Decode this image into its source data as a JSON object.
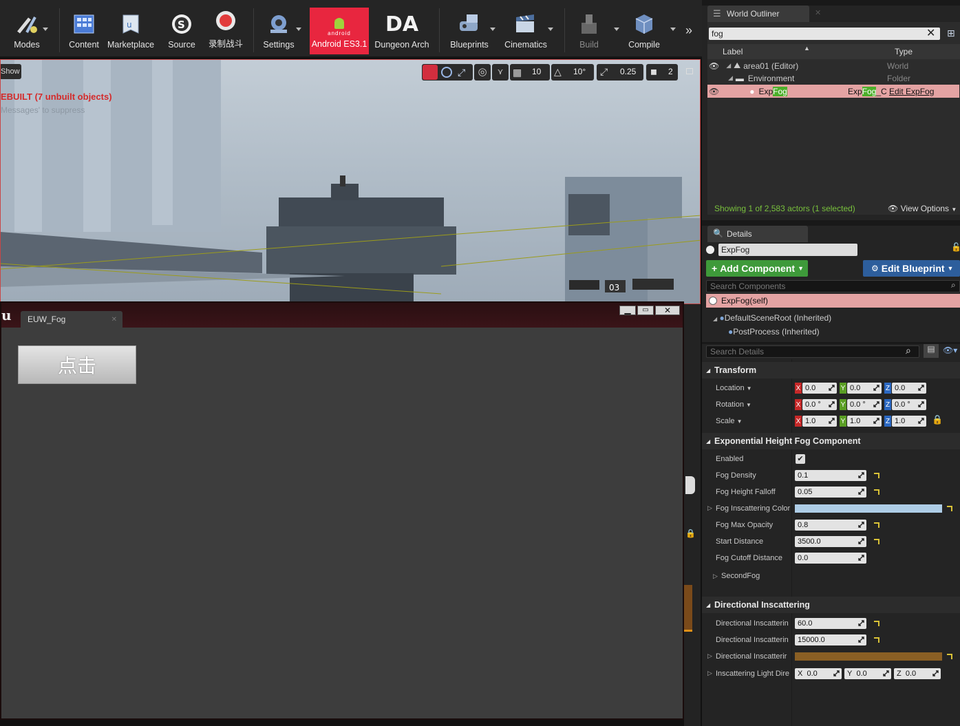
{
  "toolbar": {
    "buttons": [
      {
        "label": "Modes"
      },
      {
        "label": "Content"
      },
      {
        "label": "Marketplace"
      },
      {
        "label": "Source"
      },
      {
        "label": "录制战斗"
      },
      {
        "label": "Settings"
      },
      {
        "label": "Android ES3.1",
        "sub": "android"
      },
      {
        "label": "Dungeon Arch",
        "logo": "DA"
      },
      {
        "label": "Blueprints"
      },
      {
        "label": "Cinematics"
      },
      {
        "label": "Build"
      },
      {
        "label": "Compile"
      }
    ]
  },
  "viewport": {
    "show_button": "Show",
    "rebuild_msg": "EBUILT (7 unbuilt objects)",
    "suppress_msg": "Messages' to suppress",
    "grid_snap": "10",
    "rot_snap": "10°",
    "scale_snap": "0.25",
    "cam_speed": "2"
  },
  "euw": {
    "tab_label": "EUW_Fog",
    "button_label": "点击"
  },
  "outliner": {
    "tab_label": "World Outliner",
    "search_value": "fog",
    "col_label": "Label",
    "col_type": "Type",
    "rows": [
      {
        "label": "area01 (Editor)",
        "type": "World"
      },
      {
        "label": "Environment",
        "type": "Folder"
      },
      {
        "label_pre": "Exp",
        "label_hl": "Fog",
        "type_pre": "Exp",
        "type_hl": "Fog",
        "type_post": "_C",
        "link": "Edit ExpFog"
      }
    ],
    "status": "Showing 1 of 2,583 actors (1 selected)",
    "view_options": "View Options"
  },
  "details": {
    "tab_label": "Details",
    "name_value": "ExpFog",
    "add_component": "Add Component",
    "edit_blueprint": "Edit Blueprint",
    "search_components_placeholder": "Search Components",
    "self_item": "ExpFog(self)",
    "tree": [
      "DefaultSceneRoot (Inherited)",
      "PostProcess (Inherited)"
    ],
    "search_details_placeholder": "Search Details",
    "transform": {
      "title": "Transform",
      "location": {
        "label": "Location",
        "x": "0.0",
        "y": "0.0",
        "z": "0.0"
      },
      "rotation": {
        "label": "Rotation",
        "x": "0.0 °",
        "y": "0.0 °",
        "z": "0.0 °"
      },
      "scale": {
        "label": "Scale",
        "x": "1.0",
        "y": "1.0",
        "z": "1.0"
      }
    },
    "fog": {
      "title": "Exponential Height Fog Component",
      "enabled_label": "Enabled",
      "density_label": "Fog Density",
      "density": "0.1",
      "falloff_label": "Fog Height Falloff",
      "falloff": "0.05",
      "color_label": "Fog Inscattering Color",
      "color": "#aecde6",
      "max_opacity_label": "Fog Max Opacity",
      "max_opacity": "0.8",
      "start_label": "Start Distance",
      "start": "3500.0",
      "cutoff_label": "Fog Cutoff Distance",
      "cutoff": "0.0",
      "second_label": "SecondFog"
    },
    "directional": {
      "title": "Directional Inscattering",
      "exp_label": "Directional Inscatterin",
      "exp": "60.0",
      "start_label": "Directional Inscatterin",
      "start": "15000.0",
      "color_label": "Directional Inscatterir",
      "color": "#8a5f24",
      "light_dir_label": "Inscattering Light Dire",
      "light_x": "0.0",
      "light_y": "0.0",
      "light_z": "0.0"
    }
  }
}
